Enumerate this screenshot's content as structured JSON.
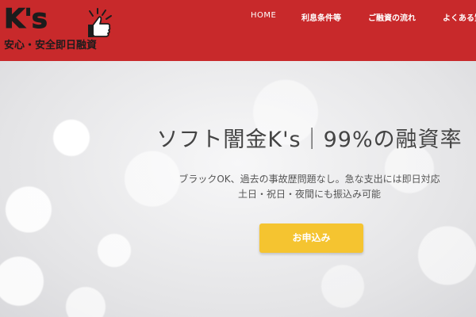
{
  "logo": {
    "name": "K's",
    "tagline": "安心・安全即日融資"
  },
  "nav": {
    "items": [
      "HOME",
      "利息条件等",
      "ご融資の流れ",
      "よくある質"
    ]
  },
  "hero": {
    "title": "ソフト闇金K's｜99%の融資率",
    "line1": "ブラックOK、過去の事故歴問題なし。急な支出には即日対応",
    "line2": "土日・祝日・夜間にも振込み可能",
    "cta_label": "お申込み"
  },
  "colors": {
    "header_bg": "#c8292b",
    "cta_bg": "#f5c430"
  }
}
